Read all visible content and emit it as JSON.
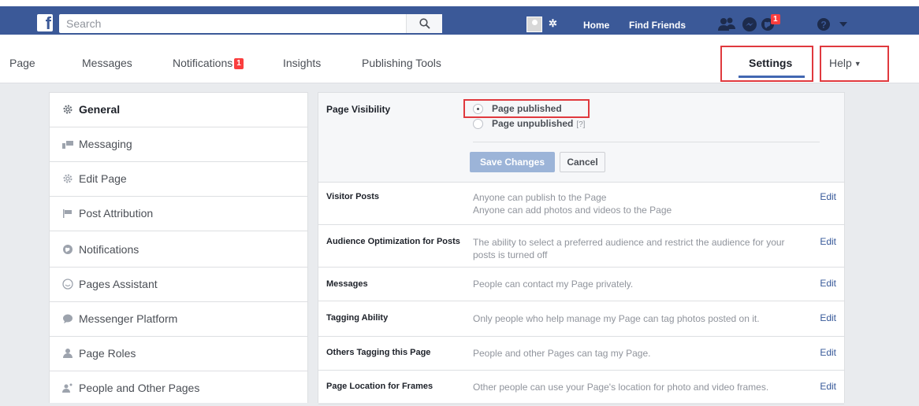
{
  "topbar": {
    "search_placeholder": "Search",
    "home_label": "Home",
    "find_friends_label": "Find Friends",
    "notifications_badge": "1",
    "accent": "#3b5998"
  },
  "pagenav": {
    "items": [
      {
        "label": "Page"
      },
      {
        "label": "Messages"
      },
      {
        "label": "Notifications",
        "badge": "1"
      },
      {
        "label": "Insights"
      },
      {
        "label": "Publishing Tools"
      },
      {
        "label": "Settings"
      },
      {
        "label": "Help"
      }
    ]
  },
  "sidebar": {
    "items": [
      {
        "label": "General",
        "icon": "gear-icon",
        "active": true
      },
      {
        "label": "Messaging",
        "icon": "messaging-icon"
      },
      {
        "label": "Edit Page",
        "icon": "gear-icon"
      },
      {
        "label": "Post Attribution",
        "icon": "flag-icon"
      },
      {
        "label": "Notifications",
        "icon": "globe-icon"
      },
      {
        "label": "Pages Assistant",
        "icon": "smiley-icon"
      },
      {
        "label": "Messenger Platform",
        "icon": "speech-bubble-icon"
      },
      {
        "label": "Page Roles",
        "icon": "person-icon"
      },
      {
        "label": "People and Other Pages",
        "icon": "people-icon"
      }
    ]
  },
  "visibility": {
    "label": "Page Visibility",
    "option_published": "Page published",
    "option_unpublished": "Page unpublished",
    "unpublished_help": "[?]",
    "selected": "Page published",
    "save_label": "Save Changes",
    "cancel_label": "Cancel"
  },
  "settings": [
    {
      "name": "Visitor Posts",
      "desc": [
        "Anyone can publish to the Page",
        "Anyone can add photos and videos to the Page"
      ],
      "edit": "Edit"
    },
    {
      "name": "Audience Optimization for Posts",
      "desc": [
        "The ability to select a preferred audience and restrict the audience for your posts is turned off"
      ],
      "edit": "Edit"
    },
    {
      "name": "Messages",
      "desc": [
        "People can contact my Page privately."
      ],
      "edit": "Edit"
    },
    {
      "name": "Tagging Ability",
      "desc": [
        "Only people who help manage my Page can tag photos posted on it."
      ],
      "edit": "Edit"
    },
    {
      "name": "Others Tagging this Page",
      "desc": [
        "People and other Pages can tag my Page."
      ],
      "edit": "Edit"
    },
    {
      "name": "Page Location for Frames",
      "desc": [
        "Other people can use your Page's location for photo and video frames."
      ],
      "edit": "Edit"
    }
  ]
}
